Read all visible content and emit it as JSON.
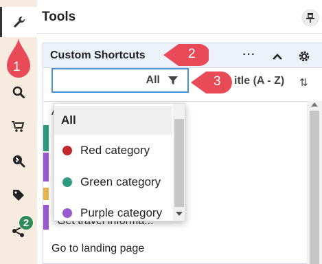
{
  "rail": {
    "items": [
      {
        "icon": "wrench-icon",
        "active": true
      },
      {
        "icon": "search-icon",
        "active": false
      },
      {
        "icon": "cart-icon",
        "active": false
      },
      {
        "icon": "search-arrow-icon",
        "active": false
      },
      {
        "icon": "tag-icon",
        "active": false
      },
      {
        "icon": "share-icon",
        "active": false
      }
    ],
    "share_badge": "2"
  },
  "panel": {
    "title": "Tools"
  },
  "card": {
    "title": "Custom Shortcuts",
    "more_label": "···"
  },
  "filter": {
    "value": "All"
  },
  "sort": {
    "label": "itle (A - Z)",
    "icon": "⇅"
  },
  "list": {
    "items": [
      {
        "text": "A",
        "color": ""
      },
      {
        "text": "Get travel informa...",
        "color": "#9b59d0"
      },
      {
        "text": "Go to landing page",
        "color": ""
      }
    ]
  },
  "dropdown": {
    "options": [
      {
        "label": "All",
        "color": "",
        "selected": true
      },
      {
        "label": "Red category",
        "color": "#c0282a",
        "selected": false
      },
      {
        "label": "Green category",
        "color": "#2e9a7e",
        "selected": false
      },
      {
        "label": "Purple category",
        "color": "#9b59d0",
        "selected": false
      }
    ]
  },
  "callouts": {
    "one": "1",
    "two": "2",
    "three": "3"
  },
  "colors": {
    "callout": "#e84a57",
    "rail_bg": "#f7ebe0",
    "focus_border": "#4a90d9",
    "green_stripe": "#2e9a7e",
    "purple_stripe": "#9b59d0",
    "yellow_stripe": "#e8b74a"
  }
}
